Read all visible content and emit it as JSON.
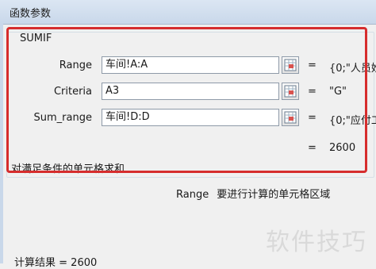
{
  "window": {
    "title": "函数参数"
  },
  "function": {
    "name": "SUMIF"
  },
  "arguments": [
    {
      "label": "Range",
      "value": "车间!A:A",
      "eq": "=",
      "result": "{0;\"人员姓"
    },
    {
      "label": "Criteria",
      "value": "A3",
      "eq": "=",
      "result": "\"G\""
    },
    {
      "label": "Sum_range",
      "value": "车间!D:D",
      "eq": "=",
      "result": "{0;\"应付工"
    }
  ],
  "total": {
    "eq": "=",
    "value": "2600"
  },
  "description": "对满足条件的单元格求和",
  "help": {
    "param": "Range",
    "text": "要进行计算的单元格区域"
  },
  "result_line": {
    "label": "计算结果 =",
    "value": "2600"
  },
  "watermark": "软件技巧",
  "colors": {
    "highlight": "#d62d2d",
    "titlebar": "#c9d8ea"
  },
  "icons": {
    "range_picker": "range-picker-icon"
  }
}
